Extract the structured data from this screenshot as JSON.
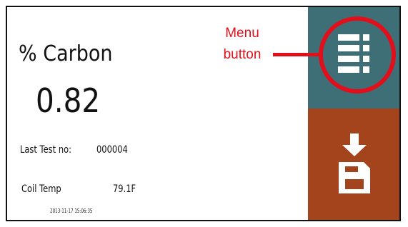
{
  "device": {
    "measurement_label": "% Carbon",
    "measurement_value": "0.82",
    "last_test_label": "Last Test no:",
    "last_test_value": "000004",
    "coil_temp_label": "Coil  Temp",
    "coil_temp_value": "79.1F",
    "timestamp": "2013-11-17 15:06:35"
  },
  "side_panel": {
    "menu_icon": "menu-list-icon",
    "save_icon": "download-save-icon",
    "menu_color": "#3f6f76",
    "save_color": "#a3441c"
  },
  "annotation": {
    "line1": "Menu",
    "line2": "button",
    "color": "#e0101b"
  }
}
